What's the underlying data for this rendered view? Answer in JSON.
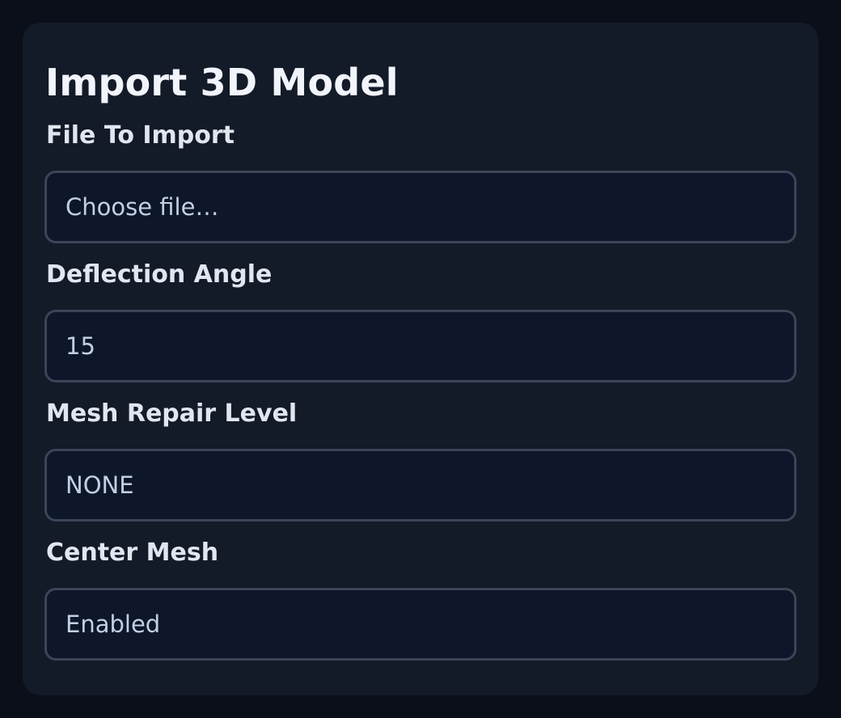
{
  "dialog": {
    "title": "Import 3D Model",
    "fields": [
      {
        "label": "File To Import",
        "value": "Choose file…"
      },
      {
        "label": "Deflection Angle",
        "value": "15"
      },
      {
        "label": "Mesh Repair Level",
        "value": "NONE"
      },
      {
        "label": "Center Mesh",
        "value": "Enabled"
      }
    ]
  },
  "colors": {
    "page_background": "#0b0f19",
    "panel_background": "#131a28",
    "field_background": "#0e172a",
    "field_border": "#3a4558",
    "label_text": "#e1e6f0",
    "value_text": "#c3cfe4"
  }
}
